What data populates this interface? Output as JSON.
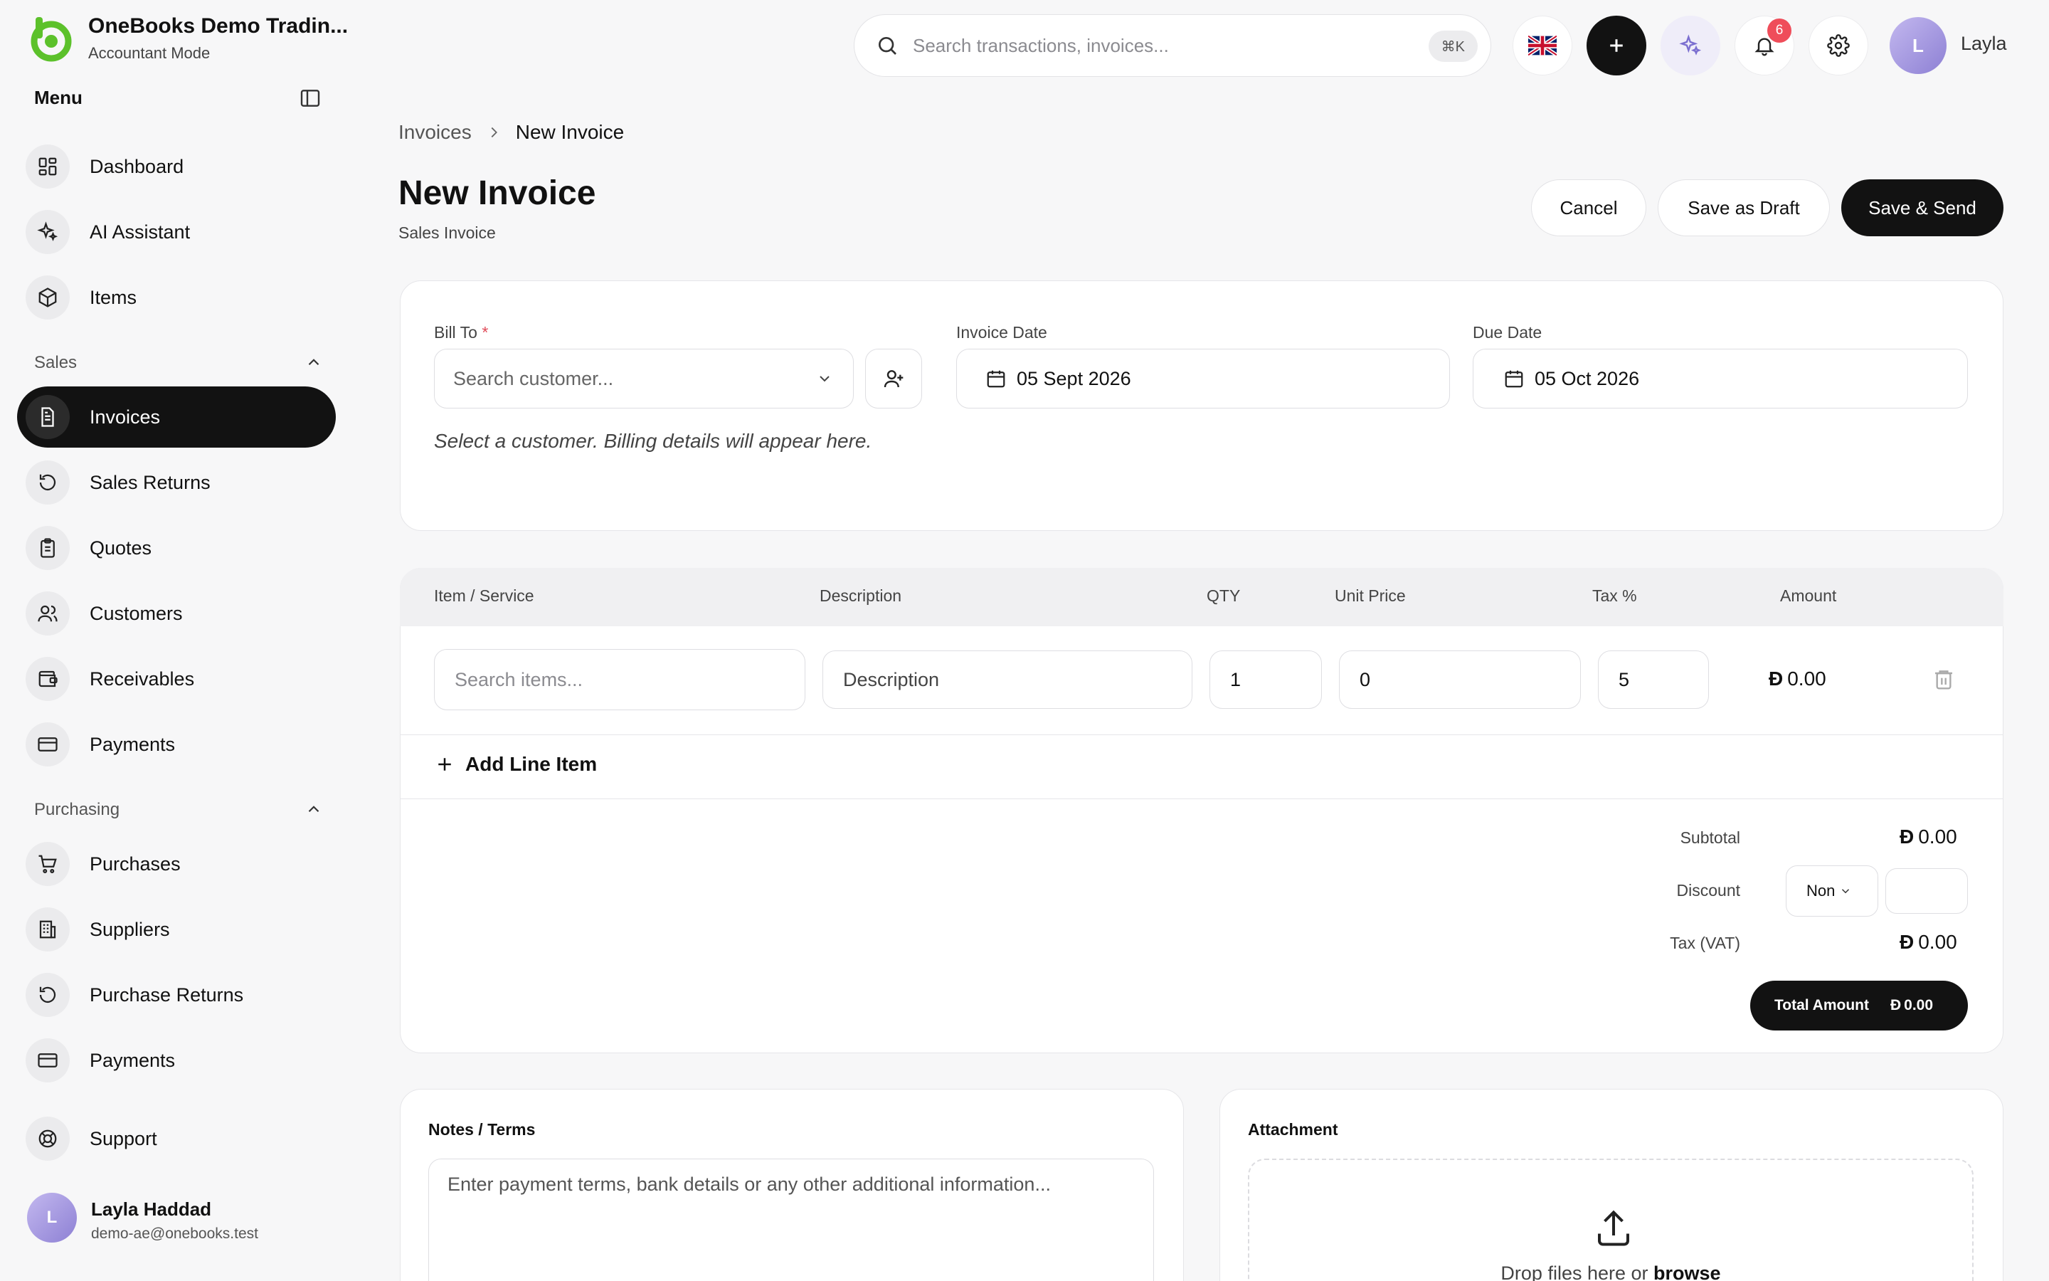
{
  "app": {
    "company": "OneBooks Demo Tradin...",
    "mode": "Accountant Mode"
  },
  "sidebar": {
    "menu_label": "Menu",
    "items_top": [
      {
        "label": "Dashboard",
        "icon": "dashboard-icon"
      },
      {
        "label": "AI Assistant",
        "icon": "sparkle-icon"
      },
      {
        "label": "Items",
        "icon": "box-icon"
      }
    ],
    "sales": {
      "label": "Sales",
      "items": [
        {
          "label": "Invoices",
          "icon": "invoice-icon",
          "active": true
        },
        {
          "label": "Sales Returns",
          "icon": "return-icon"
        },
        {
          "label": "Quotes",
          "icon": "clipboard-icon"
        },
        {
          "label": "Customers",
          "icon": "users-icon"
        },
        {
          "label": "Receivables",
          "icon": "wallet-icon"
        },
        {
          "label": "Payments",
          "icon": "card-icon"
        }
      ]
    },
    "purchasing": {
      "label": "Purchasing",
      "items": [
        {
          "label": "Purchases",
          "icon": "cart-icon"
        },
        {
          "label": "Suppliers",
          "icon": "building-icon"
        },
        {
          "label": "Purchase Returns",
          "icon": "return-icon"
        },
        {
          "label": "Payments",
          "icon": "card-icon"
        }
      ]
    },
    "support_label": "Support",
    "user": {
      "initial": "L",
      "name": "Layla Haddad",
      "email": "demo-ae@onebooks.test"
    }
  },
  "topbar": {
    "search_placeholder": "Search transactions, invoices...",
    "shortcut": "⌘K",
    "notification_count": "6",
    "user_initial": "L",
    "user_name": "Layla"
  },
  "page": {
    "breadcrumb": [
      "Invoices",
      "New Invoice"
    ],
    "title": "New Invoice",
    "subtitle": "Sales Invoice",
    "actions": {
      "cancel": "Cancel",
      "draft": "Save as Draft",
      "send": "Save & Send"
    }
  },
  "form": {
    "bill_to_label": "Bill To",
    "required_mark": "*",
    "customer_placeholder": "Search customer...",
    "invoice_date_label": "Invoice Date",
    "invoice_date": "05 Sept 2026",
    "due_date_label": "Due Date",
    "due_date": "05 Oct 2026",
    "billing_hint": "Select a customer. Billing details will appear here."
  },
  "lines": {
    "headers": {
      "item": "Item / Service",
      "description": "Description",
      "qty": "QTY",
      "unit_price": "Unit Price",
      "tax": "Tax %",
      "amount": "Amount"
    },
    "row": {
      "item_placeholder": "Search items...",
      "description_placeholder": "Description",
      "qty": "1",
      "unit_price": "0",
      "tax": "5",
      "currency": "Ð",
      "amount": "0.00"
    },
    "add_label": "Add Line Item"
  },
  "summary": {
    "currency": "Ð",
    "subtotal_label": "Subtotal",
    "subtotal": "0.00",
    "discount_label": "Discount",
    "discount_type": "Non",
    "tax_label": "Tax (VAT)",
    "tax": "0.00",
    "total_label": "Total Amount",
    "total": "0.00"
  },
  "notes": {
    "label": "Notes / Terms",
    "placeholder": "Enter payment terms, bank details or any other additional information..."
  },
  "attachment": {
    "label": "Attachment",
    "drop_text": "Drop files here or",
    "browse_text": "browse"
  },
  "colors": {
    "accent": "#121212",
    "brand_green": "#5cc12b",
    "badge_red": "#ef4d5a",
    "avatar_purple": "#a89be3"
  }
}
